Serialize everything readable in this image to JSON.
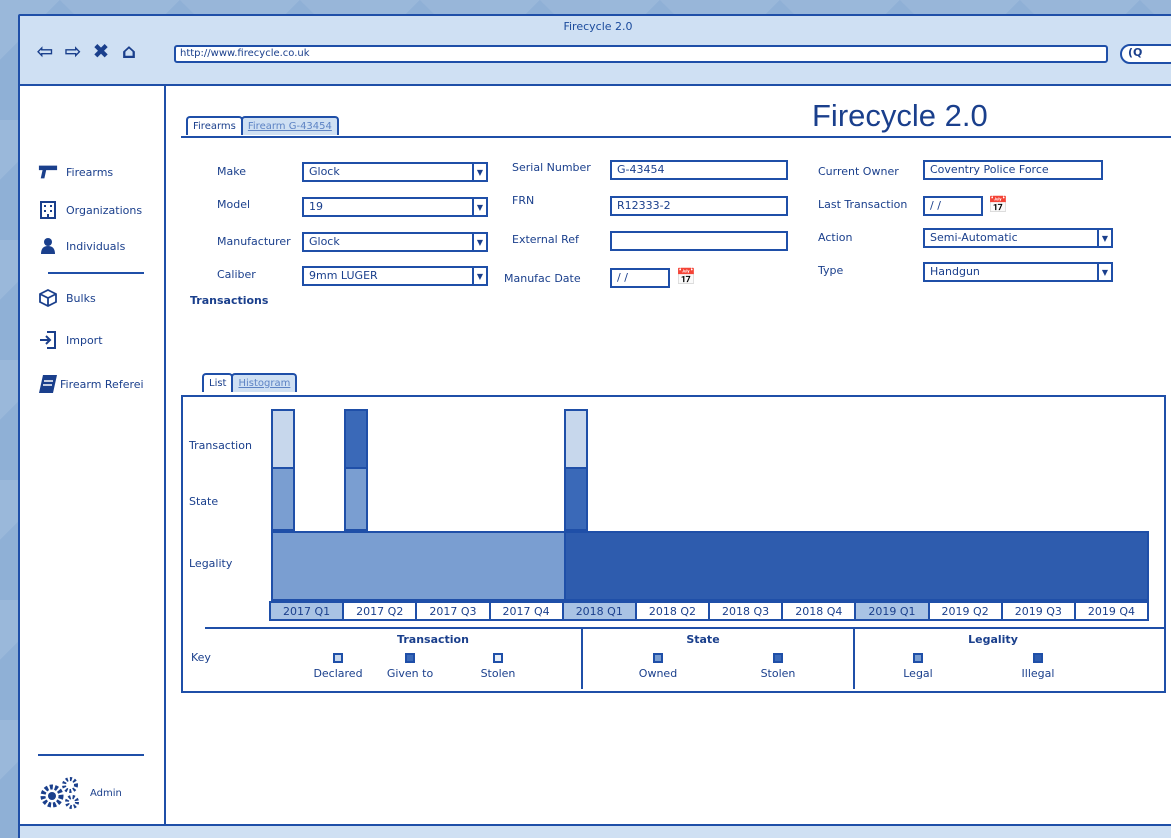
{
  "window": {
    "title": "Firecycle 2.0",
    "url": "http://www.firecycle.co.uk"
  },
  "nav": {
    "back_icon": "back-arrow-icon",
    "forward_icon": "forward-arrow-icon",
    "stop_icon": "close-icon",
    "home_icon": "home-icon",
    "search_icon": "search-icon"
  },
  "app": {
    "title": "Firecycle 2.0"
  },
  "sidebar": {
    "items": [
      {
        "label": "Firearms",
        "icon": "gun-icon"
      },
      {
        "label": "Organizations",
        "icon": "building-icon"
      },
      {
        "label": "Individuals",
        "icon": "person-icon"
      },
      {
        "label": "Bulks",
        "icon": "box-icon"
      },
      {
        "label": "Import",
        "icon": "import-icon"
      },
      {
        "label": "Firearm Referei",
        "icon": "book-icon"
      }
    ],
    "admin_label": "Admin"
  },
  "tabs": {
    "firearms": "Firearms",
    "record": "Firearm G-43454"
  },
  "form": {
    "make_label": "Make",
    "make_value": "Glock",
    "model_label": "Model",
    "model_value": "19",
    "manufacturer_label": "Manufacturer",
    "manufacturer_value": "Glock",
    "caliber_label": "Caliber",
    "caliber_value": "9mm LUGER",
    "serial_label": "Serial Number",
    "serial_value": "G-43454",
    "frn_label": "FRN",
    "frn_value": "R12333-2",
    "external_label": "External Ref",
    "external_value": "",
    "manufac_label": "Manufac Date",
    "manufac_value": "/ /",
    "owner_label": "Current Owner",
    "owner_value": "Coventry Police Force",
    "last_tx_label": "Last Transaction",
    "last_tx_value": "/ /",
    "action_label": "Action",
    "action_value": "Semi-Automatic",
    "type_label": "Type",
    "type_value": "Handgun"
  },
  "transactions": {
    "label": "Transactions",
    "tab_list": "List",
    "tab_histogram": "Histogram"
  },
  "chart_data": {
    "type": "bar",
    "rows": [
      "Transaction",
      "State",
      "Legality"
    ],
    "categories": [
      "2017 Q1",
      "2017 Q2",
      "2017 Q3",
      "2017 Q4",
      "2018 Q1",
      "2018 Q2",
      "2018 Q3",
      "2018 Q4",
      "2019 Q1",
      "2019 Q2",
      "2019 Q3",
      "2019 Q4"
    ],
    "highlighted": [
      "2017 Q1",
      "2018 Q1",
      "2019 Q1"
    ],
    "events": [
      {
        "category": "2017 Q1",
        "transaction": "Declared",
        "state": "Owned"
      },
      {
        "category": "2017 Q2",
        "transaction": "Given to",
        "state": "Owned"
      },
      {
        "category": "2018 Q1",
        "transaction": "Declared",
        "state": "Stolen"
      }
    ],
    "legality": [
      {
        "from": "2017 Q1",
        "to": "2018 Q1",
        "value": "Legal"
      },
      {
        "from": "2018 Q1",
        "to": "2019 Q4",
        "value": "Illegal"
      }
    ],
    "colors": {
      "Declared": "#c7d7ec",
      "Given to": "#3a69b8",
      "Stolen_tx": "#e6eef8",
      "Owned": "#7a9ed1",
      "Stolen_state": "#3a69b8",
      "Legal": "#7a9ed1",
      "Illegal": "#2e5cae"
    }
  },
  "key": {
    "title": "Key",
    "groups": [
      {
        "title": "Transaction",
        "items": [
          "Declared",
          "Given to",
          "Stolen"
        ]
      },
      {
        "title": "State",
        "items": [
          "Owned",
          "Stolen"
        ]
      },
      {
        "title": "Legality",
        "items": [
          "Legal",
          "Illegal"
        ]
      }
    ]
  }
}
